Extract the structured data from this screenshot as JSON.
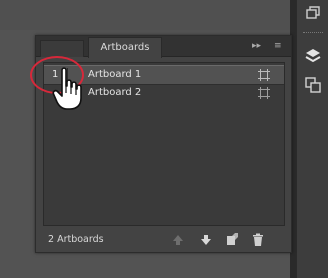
{
  "panel": {
    "tabs": [
      {
        "label": ""
      },
      {
        "label": "Artboards"
      }
    ],
    "tab_controls": {
      "collapse": "▸▸",
      "menu": "≡"
    },
    "artboards": [
      {
        "number": "1",
        "name": "Artboard 1",
        "selected": true
      },
      {
        "number": "",
        "name": "Artboard 2",
        "selected": false
      }
    ],
    "footer": {
      "count_label": "2 Artboards"
    }
  },
  "colors": {
    "highlight_ring": "#d7283a",
    "panel_bg": "#434343",
    "selected_row": "#525252"
  },
  "icons": {
    "dock": [
      "artboard-tool-icon",
      "layers-icon",
      "artboards-panel-icon"
    ],
    "footer": [
      "move-up-icon",
      "move-down-icon",
      "new-artboard-icon",
      "delete-icon"
    ]
  }
}
